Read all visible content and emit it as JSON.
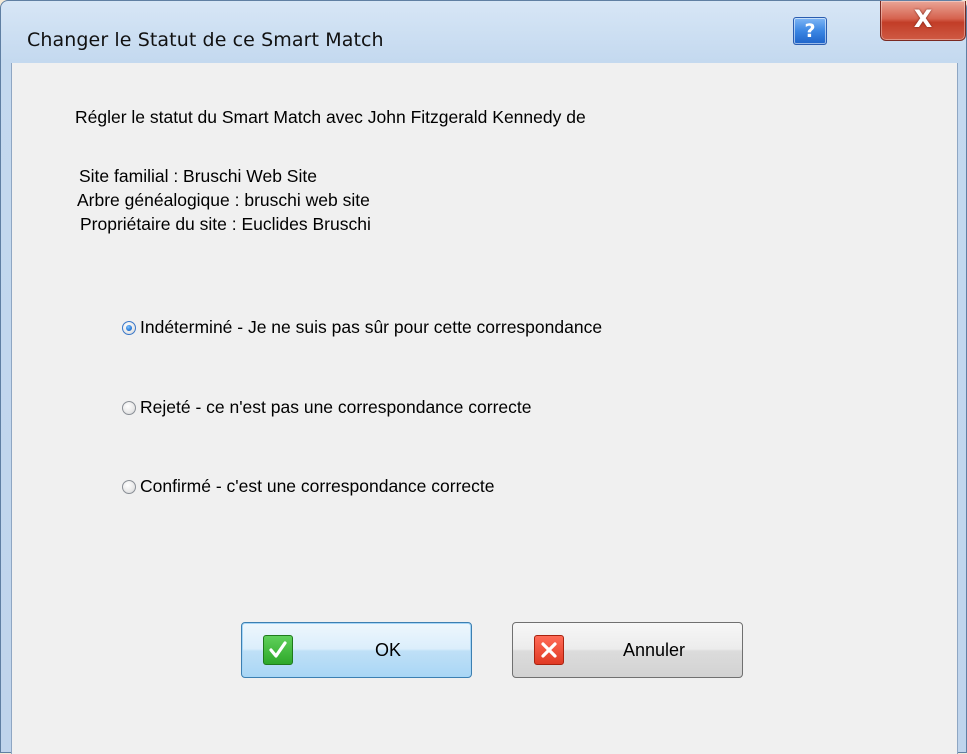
{
  "window": {
    "title": "Changer le Statut de ce Smart Match",
    "help_label": "?",
    "close_label": "X"
  },
  "content": {
    "intro": "Régler le statut du Smart Match avec John Fitzgerald Kennedy de",
    "site_line": "Site familial : Bruschi Web Site",
    "tree_line": "Arbre généalogique : bruschi web site",
    "owner_line": "Propriétaire du site : Euclides Bruschi"
  },
  "options": [
    {
      "label": "Indéterminé - Je ne suis pas sûr pour cette correspondance",
      "selected": true
    },
    {
      "label": "Rejeté - ce n'est pas une correspondance correcte",
      "selected": false
    },
    {
      "label": "Confirmé - c'est une correspondance correcte",
      "selected": false
    }
  ],
  "buttons": {
    "ok_label": "OK",
    "ok_icon": "checkmark-icon",
    "cancel_label": "Annuler",
    "cancel_icon": "cross-icon"
  },
  "colors": {
    "ok_icon_bg": "#2ea82a",
    "cancel_icon_bg": "#e03a24",
    "close_button_bg": "#c23d27",
    "help_button_bg": "#3b86e3"
  }
}
